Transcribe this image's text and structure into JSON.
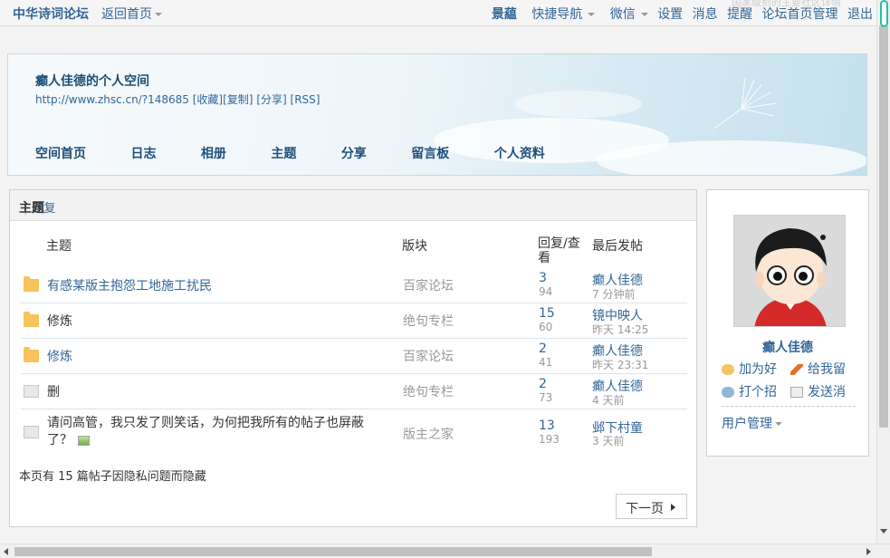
{
  "topbar": {
    "site_name": "中华诗词论坛",
    "back_home": "返回首页",
    "right_items": [
      {
        "label": "景藴",
        "bold": true
      },
      {
        "label": "快捷导航",
        "caret": true
      },
      {
        "label": "微信",
        "caret": true
      },
      {
        "label": "设置"
      },
      {
        "label": "消息"
      },
      {
        "label": "提醒"
      },
      {
        "label": "论坛首页管理"
      },
      {
        "label": "退出"
      }
    ]
  },
  "banner": {
    "title": "癫人佳德的个人空间",
    "url": "http://www.zhsc.cn/?148685",
    "links": [
      "[收藏]",
      "[复制]",
      "[分享]",
      "[RSS]"
    ],
    "nav": [
      "空间首页",
      "日志",
      "相册",
      "主题",
      "分享",
      "留言板",
      "个人资料"
    ]
  },
  "tabs": {
    "active": "主题",
    "other": "回复"
  },
  "table": {
    "headers": {
      "subject": "主题",
      "forum": "版块",
      "replies": "回复/查看",
      "last": "最后发帖"
    },
    "rows": [
      {
        "icon": "folder-new-icon",
        "subject": "有感某版主抱怨工地施工扰民",
        "subject_link": true,
        "forum": "百家论坛",
        "replies": "3",
        "views": "94",
        "author": "癫人佳德",
        "time": "7 分钟前"
      },
      {
        "icon": "folder-new-icon",
        "subject": "修炼",
        "subject_link": false,
        "forum": "绝句专栏",
        "replies": "15",
        "views": "60",
        "author": "镜中映人",
        "time": "昨天 14:25"
      },
      {
        "icon": "folder-new-icon",
        "subject": "修炼",
        "subject_link": true,
        "forum": "百家论坛",
        "replies": "2",
        "views": "41",
        "author": "癫人佳德",
        "time": "昨天 23:31"
      },
      {
        "icon": "thread-closed-icon",
        "subject": "删",
        "subject_link": false,
        "forum": "绝句专栏",
        "replies": "2",
        "views": "73",
        "author": "癫人佳德",
        "time": "4 天前"
      },
      {
        "icon": "thread-closed-icon",
        "subject": "请问高管，我只发了则笑话，为何把我所有的帖子也屏蔽了？",
        "subject_link": false,
        "forum": "版主之家",
        "replies": "13",
        "views": "193",
        "author": "邺下村童",
        "time": "3 天前"
      }
    ]
  },
  "hidden_note": "本页有 15 篇帖子因隐私问题而隐藏",
  "next_button": "下一页",
  "profile": {
    "name": "癫人佳德",
    "actions": [
      "加为好",
      "给我留",
      "打个招",
      "发送消"
    ],
    "user_mgmt": "用户管理"
  },
  "faint_top": "国家级别的主要社区详情",
  "colors": {
    "link": "#336699",
    "folder": "#f8c35b",
    "scroll_accent": "#1fbfaa"
  }
}
